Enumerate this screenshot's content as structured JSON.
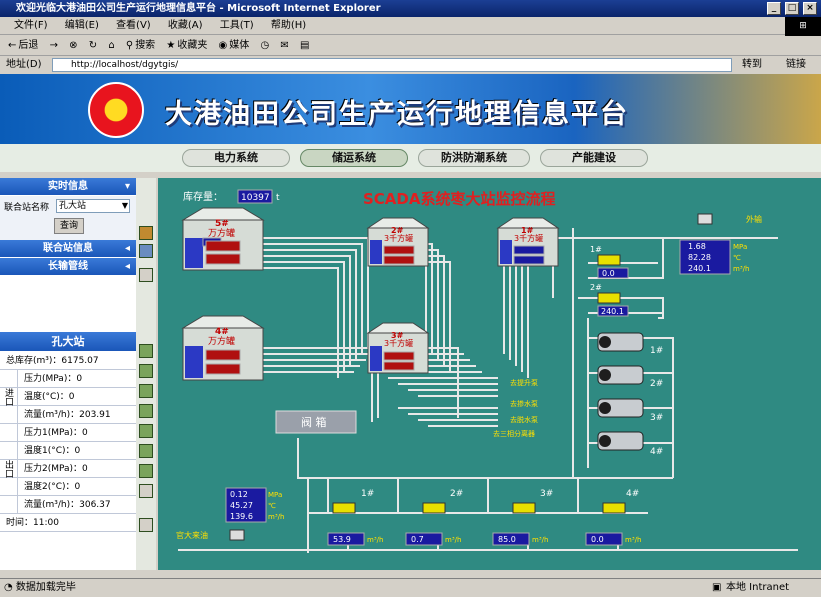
{
  "window": {
    "title": "欢迎光临大港油田公司生产运行地理信息平台 - Microsoft Internet Explorer",
    "min": "_",
    "max": "□",
    "close": "×"
  },
  "menu": [
    "文件(F)",
    "编辑(E)",
    "查看(V)",
    "收藏(A)",
    "工具(T)",
    "帮助(H)"
  ],
  "toolbar": {
    "back": "后退",
    "search": "搜索",
    "favorites": "收藏夹",
    "media": "媒体"
  },
  "address": {
    "label": "地址(D)",
    "url": "http://localhost/dgytgis/",
    "go": "转到",
    "links": "链接"
  },
  "banner": {
    "title": "大港油田公司生产运行地理信息平台"
  },
  "nav": {
    "tabs": [
      "电力系统",
      "储运系统",
      "防洪防潮系统",
      "产能建设"
    ]
  },
  "left": {
    "realtime_header": "实时信息",
    "station_label": "联合站名称",
    "station_value": "孔大站",
    "query": "查询",
    "union_info": "联合站信息",
    "pipeline": "长输管线",
    "station_title": "孔大站",
    "rows": [
      "总库存(m³)：6175.07",
      "压力(MPa)：0",
      "温度(°C)：0",
      "流量(m³/h)：203.91",
      "压力1(MPa)：0",
      "温度1(°C)：0",
      "压力2(MPa)：0",
      "温度2(°C)：0",
      "流量(m³/h)：306.37",
      "时间：11:00"
    ],
    "inlet": "进口",
    "outlet": "出口"
  },
  "scada": {
    "title": "SCADA系统枣大站监控流程",
    "storage_label": "库存量：",
    "storage_value": "10397",
    "storage_unit": "t",
    "tanks": [
      {
        "name": "5#",
        "type": "万方罐"
      },
      {
        "name": "2#",
        "type": "3千方罐"
      },
      {
        "name": "1#",
        "type": "3千方罐"
      },
      {
        "name": "4#",
        "type": "万方罐"
      },
      {
        "name": "3#",
        "type": "3千方罐"
      }
    ],
    "valve_box": "阀 箱",
    "outlet_label": "外输",
    "pumps_to": [
      "去提升泵",
      "去掺水泵",
      "去脱水泵",
      "去三相分离器"
    ],
    "readings_right": [
      "1.68",
      "82.28",
      "240.1"
    ],
    "units_right": [
      "MPa",
      "℃",
      "m³/h"
    ],
    "meter1": "0.0",
    "meter2": "240.1",
    "pump_labels": [
      "1#",
      "2#",
      "3#",
      "4#"
    ],
    "meter_labels_top": [
      "1#",
      "2#"
    ],
    "readings_left": [
      "0.12",
      "45.27",
      "139.6"
    ],
    "units_left": [
      "MPa",
      "℃",
      "m³/h"
    ],
    "bottom_meters": [
      "1#",
      "2#",
      "3#",
      "4#"
    ],
    "bottom_values": [
      "53.9",
      "0.7",
      "85.0",
      "0.0"
    ],
    "bottom_unit": "m³/h",
    "incoming": "官大来油"
  },
  "status": {
    "text": "数据加载完毕",
    "zone": "本地 Intranet"
  }
}
